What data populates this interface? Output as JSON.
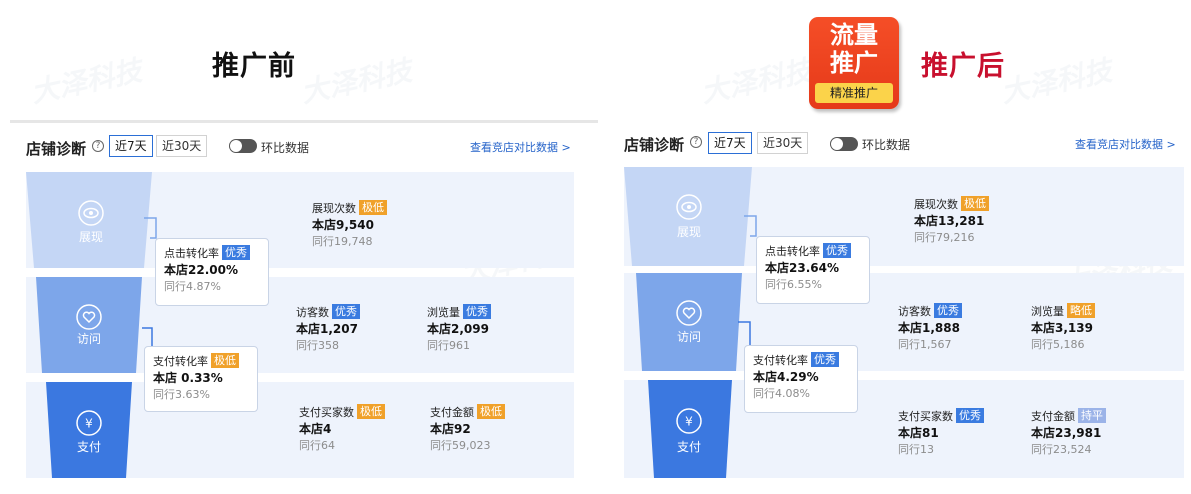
{
  "headings": {
    "before": "推广前",
    "after": "推广后"
  },
  "promo_badge": {
    "line1": "流量",
    "line2": "推广",
    "sub": "精准推广",
    "color": "#e53919"
  },
  "watermark": "大泽科技",
  "panels": [
    {
      "shop_title": "店铺诊断",
      "help_icon": "help-circle-icon",
      "range_options": [
        "近7天",
        "近30天"
      ],
      "active_range": "近7天",
      "toggle_label": "环比数据",
      "compare_link": "查看竞店对比数据 >",
      "stages": [
        {
          "label": "展现",
          "icon": "eye-icon"
        },
        {
          "label": "访问",
          "icon": "heart-icon"
        },
        {
          "label": "支付",
          "icon": "yen-icon"
        }
      ],
      "conversions": [
        {
          "title": "点击转化率",
          "badge": "优秀",
          "badge_color": "blue",
          "value": "本店22.00%",
          "peer": "同行4.87%"
        },
        {
          "title": "支付转化率",
          "badge": "极低",
          "badge_color": "orange",
          "value": "本店 0.33%",
          "peer": "同行3.63%"
        }
      ],
      "impressions": {
        "title": "展现次数",
        "badge": "极低",
        "badge_color": "orange",
        "value": "本店9,540",
        "peer": "同行19,748"
      },
      "visitors": {
        "title": "访客数",
        "badge": "优秀",
        "badge_color": "blue",
        "value": "本店1,207",
        "peer": "同行358"
      },
      "pageviews": {
        "title": "浏览量",
        "badge": "优秀",
        "badge_color": "blue",
        "value": "本店2,099",
        "peer": "同行961"
      },
      "buyers": {
        "title": "支付买家数",
        "badge": "极低",
        "badge_color": "orange",
        "value": "本店4",
        "peer": "同行64"
      },
      "amount": {
        "title": "支付金额",
        "badge": "极低",
        "badge_color": "orange",
        "value": "本店92",
        "peer": "同行59,023"
      }
    },
    {
      "shop_title": "店铺诊断",
      "help_icon": "help-circle-icon",
      "range_options": [
        "近7天",
        "近30天"
      ],
      "active_range": "近7天",
      "toggle_label": "环比数据",
      "compare_link": "查看竞店对比数据 >",
      "stages": [
        {
          "label": "展现",
          "icon": "eye-icon"
        },
        {
          "label": "访问",
          "icon": "heart-icon"
        },
        {
          "label": "支付",
          "icon": "yen-icon"
        }
      ],
      "conversions": [
        {
          "title": "点击转化率",
          "badge": "优秀",
          "badge_color": "blue",
          "value": "本店23.64%",
          "peer": "同行6.55%"
        },
        {
          "title": "支付转化率",
          "badge": "优秀",
          "badge_color": "blue",
          "value": "本店4.29%",
          "peer": "同行4.08%"
        }
      ],
      "impressions": {
        "title": "展现次数",
        "badge": "极低",
        "badge_color": "orange",
        "value": "本店13,281",
        "peer": "同行79,216"
      },
      "visitors": {
        "title": "访客数",
        "badge": "优秀",
        "badge_color": "blue",
        "value": "本店1,888",
        "peer": "同行1,567"
      },
      "pageviews": {
        "title": "浏览量",
        "badge": "略低",
        "badge_color": "orange",
        "value": "本店3,139",
        "peer": "同行5,186"
      },
      "buyers": {
        "title": "支付买家数",
        "badge": "优秀",
        "badge_color": "blue",
        "value": "本店81",
        "peer": "同行13"
      },
      "amount": {
        "title": "支付金额",
        "badge": "持平",
        "badge_color": "lavender",
        "value": "本店23,981",
        "peer": "同行23,524"
      }
    }
  ],
  "colors": {
    "stage1": "#c4d6f5",
    "stage2": "#7da6ea",
    "stage3": "#3b78e0",
    "row_bg": "#eef3fc",
    "badge_blue": "#3a7be0",
    "badge_orange": "#f0a12a",
    "link": "#2563c9",
    "after_heading": "#c8102e"
  }
}
